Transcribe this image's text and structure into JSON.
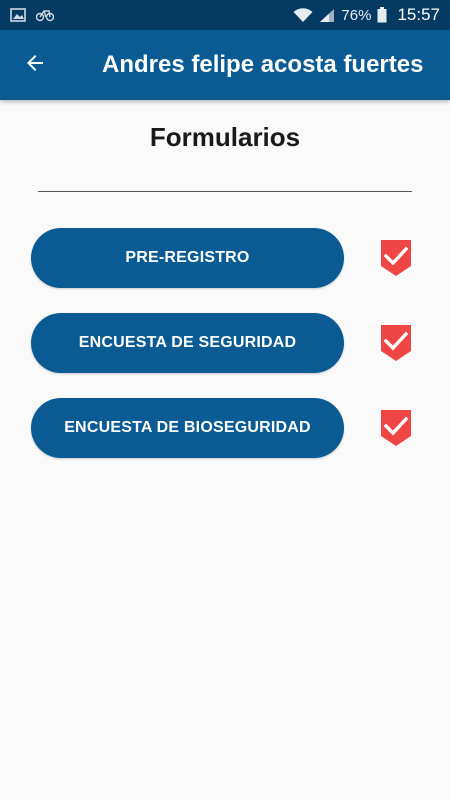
{
  "status_bar": {
    "left_icons": [
      "image-icon",
      "bike-icon"
    ],
    "right_icons": [
      "wifi-icon",
      "signal-icon",
      "battery-icon"
    ],
    "battery": "76%",
    "time": "15:57"
  },
  "app_bar": {
    "back_icon": "arrow-left-icon",
    "title": "Andres felipe acosta fuertes"
  },
  "main": {
    "section_title": "Formularios",
    "forms": [
      {
        "label": "PRE-REGISTRO",
        "completed": true,
        "status_icon": "check-badge-icon"
      },
      {
        "label": "ENCUESTA DE SEGURIDAD",
        "completed": true,
        "status_icon": "check-badge-icon"
      },
      {
        "label": "ENCUESTA DE BIOSEGURIDAD",
        "completed": true,
        "status_icon": "check-badge-icon"
      }
    ]
  },
  "colors": {
    "status_bar": "#053a63",
    "app_bar": "#0a5a93",
    "button": "#0a5a93",
    "check_badge": "#f04545",
    "background": "#fafafa"
  }
}
